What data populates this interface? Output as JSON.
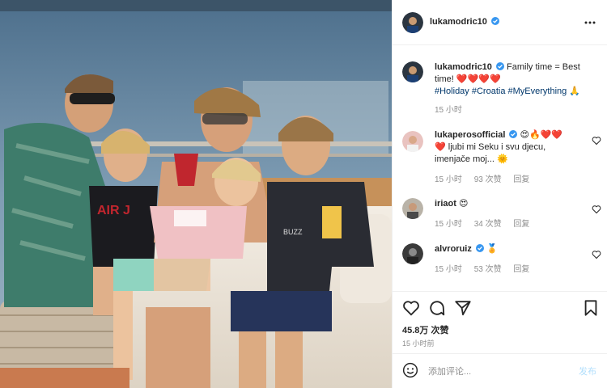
{
  "post": {
    "author": "lukamodric10",
    "caption": {
      "author": "lukamodric10",
      "text": "Family time = Best time! ❤️❤️❤️❤️",
      "hashtags": [
        "#Holiday",
        "#Croatia",
        "#MyEverything"
      ],
      "trailing_emoji": "🙏",
      "time": "15 小时"
    },
    "comments": [
      {
        "user": "lukaperosofficial",
        "text_line1": "😍🔥❤️❤️",
        "text_line2": "❤️ ljubi mi Seku i svu djecu,",
        "text_line3": "imenjače moj... 🌞",
        "time": "15 小时",
        "likes": "93 次赞",
        "reply": "回复"
      },
      {
        "user": "iriaot",
        "text": "😍",
        "time": "15 小时",
        "likes": "34 次赞",
        "reply": "回复"
      },
      {
        "user": "alvroruiz",
        "text": "🏅",
        "time": "15 小时",
        "likes": "53 次赞",
        "reply": "回复"
      }
    ],
    "likes": "45.8万 次赞",
    "posted": "15 小时前",
    "add_comment_placeholder": "添加评论...",
    "post_button": "发布"
  },
  "colors": {
    "verified": "#3897f0",
    "link": "#00376b",
    "muted": "#8e8e8e",
    "post_disabled": "#b2dffc",
    "heart": "#ed4956"
  },
  "icons": [
    "more-icon",
    "verified-icon",
    "heart-icon",
    "comment-icon",
    "share-icon",
    "bookmark-icon",
    "emoji-icon"
  ]
}
